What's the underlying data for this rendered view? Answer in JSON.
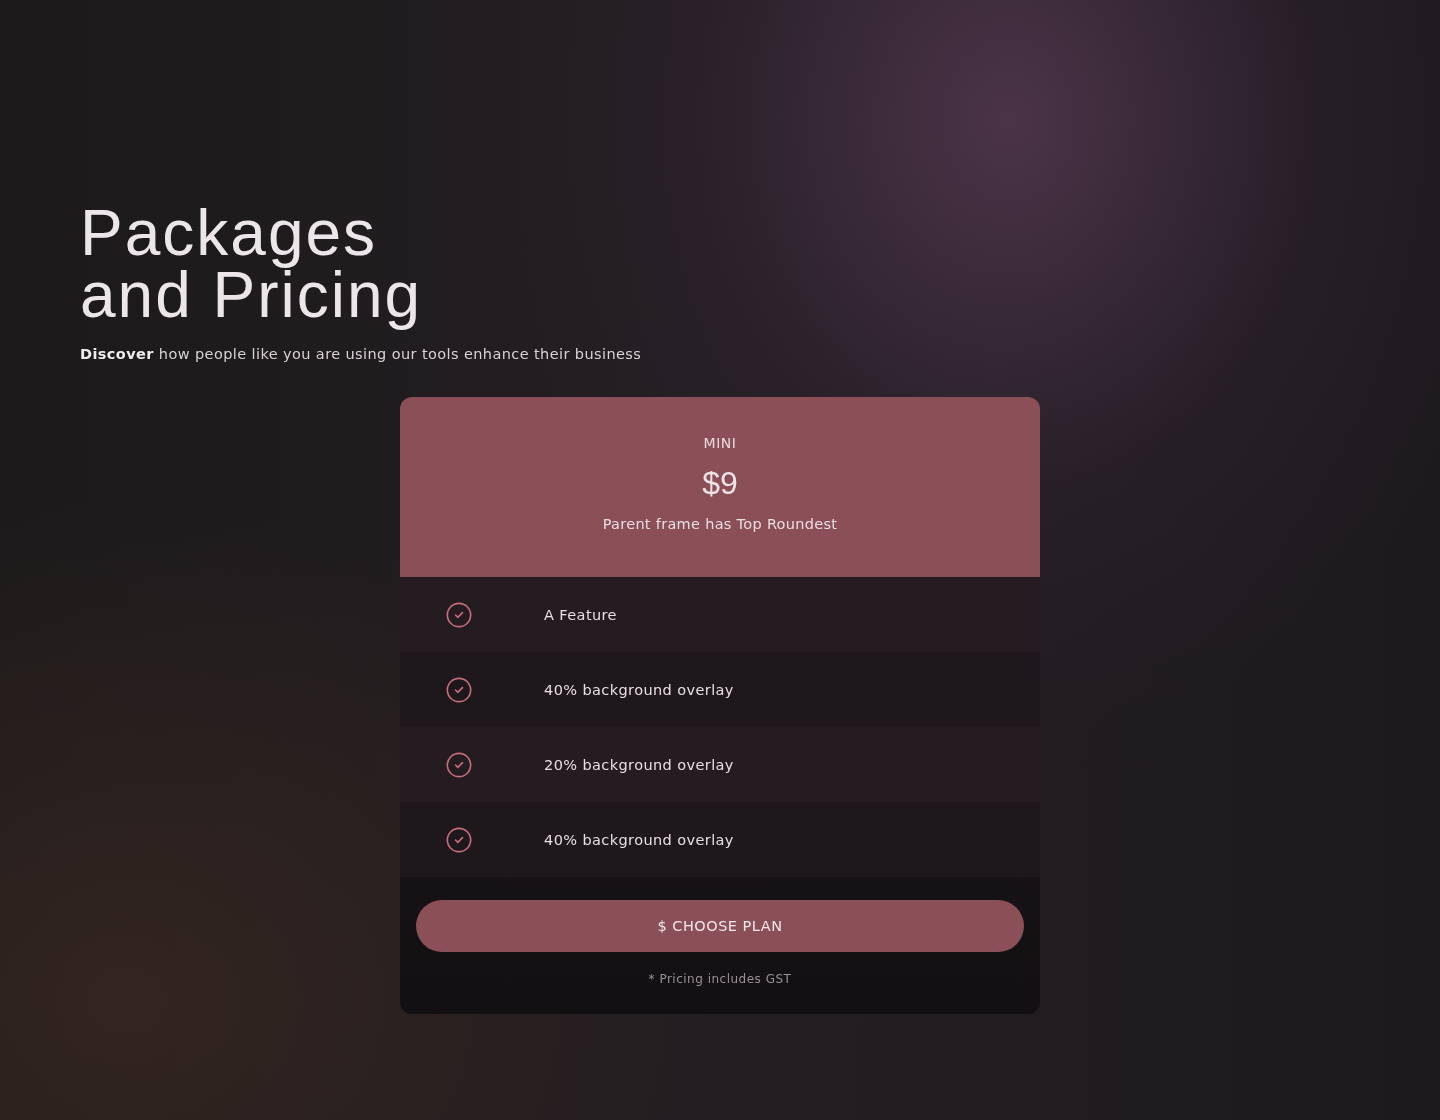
{
  "heading": {
    "lines": [
      "Packages",
      "and Pricing"
    ]
  },
  "subtitle": "**Discover** how people like you are using our tools enhance their business",
  "plan": {
    "name": "MINI",
    "price": "$9",
    "note": "Parent frame has Top Roundest",
    "features": [
      "A Feature",
      "40% background overlay",
      "20% background overlay",
      "40% background overlay"
    ],
    "button": "$ CHOOSE PLAN",
    "footnote": "* Pricing includes GST"
  }
}
